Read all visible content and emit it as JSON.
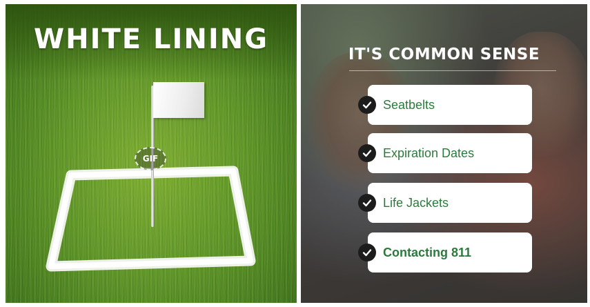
{
  "left_panel": {
    "headline": "WHITE LINING",
    "badge": "GIF"
  },
  "right_panel": {
    "heading": "IT'S COMMON SENSE",
    "items": [
      {
        "label": "Seatbelts",
        "emphasis": false
      },
      {
        "label": "Expiration Dates",
        "emphasis": false
      },
      {
        "label": "Life Jackets",
        "emphasis": false
      },
      {
        "label": "Contacting 811",
        "emphasis": true
      }
    ]
  },
  "colors": {
    "item_text": "#2c7a3b",
    "check_circle": "#1c1c1c",
    "card_background": "#ffffff"
  }
}
